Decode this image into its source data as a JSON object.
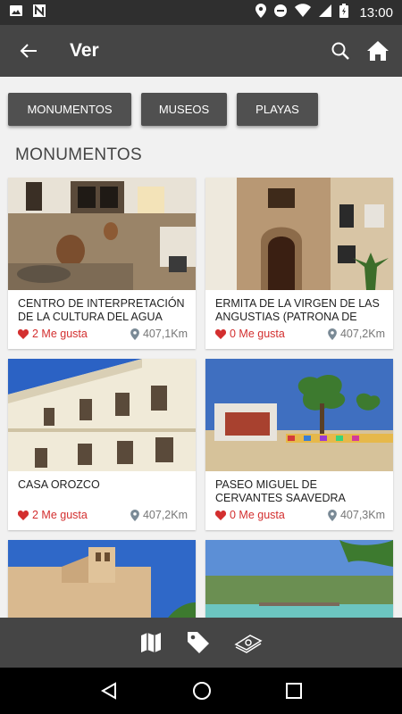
{
  "status_bar": {
    "time": "13:00",
    "icons": [
      "photo-icon",
      "n-icon",
      "location-icon",
      "dnd-icon",
      "wifi-icon",
      "signal-icon",
      "battery-icon"
    ]
  },
  "app_bar": {
    "title": "Ver",
    "icons": [
      "back-arrow-icon",
      "search-icon",
      "home-icon"
    ]
  },
  "chips": [
    {
      "label": "MONUMENTOS"
    },
    {
      "label": "MUSEOS"
    },
    {
      "label": "PLAYAS"
    }
  ],
  "section": {
    "title": "MONUMENTOS"
  },
  "cards": [
    {
      "name": "CENTRO DE INTERPRETACIÓN DE LA CULTURA DEL AGUA",
      "likes": "2 Me gusta",
      "distance": "407,1Km",
      "image": "interior-museum"
    },
    {
      "name": "ERMITA DE LA VIRGEN DE LAS ANGUSTIAS (PATRONA DE",
      "likes": "0 Me gusta",
      "distance": "407,2Km",
      "image": "church-facade"
    },
    {
      "name": "CASA OROZCO",
      "likes": "2 Me gusta",
      "distance": "407,2Km",
      "image": "white-building"
    },
    {
      "name": "PASEO MIGUEL DE CERVANTES SAAVEDRA",
      "likes": "0 Me gusta",
      "distance": "407,3Km",
      "image": "park-promenade"
    },
    {
      "name": "",
      "likes": "",
      "distance": "",
      "image": "church-tower"
    },
    {
      "name": "",
      "likes": "",
      "distance": "",
      "image": "lake-park"
    }
  ],
  "bottom_bar": {
    "icons": [
      "map-icon",
      "tag-icon",
      "money-icon"
    ]
  },
  "nav_bar": {
    "icons": [
      "back-triangle-icon",
      "home-circle-icon",
      "recents-square-icon"
    ]
  },
  "colors": {
    "status_bar": "#2f2f2f",
    "app_bar": "#454545",
    "chip": "#505050",
    "like": "#d32f2f",
    "distance": "#777777"
  }
}
